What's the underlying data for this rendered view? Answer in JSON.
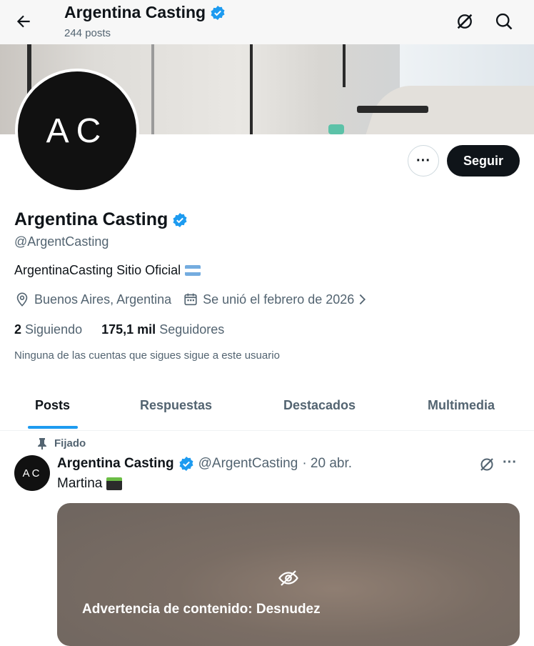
{
  "header": {
    "title": "Argentina Casting",
    "posts_count": "244 posts"
  },
  "profile": {
    "avatar_text": "AC",
    "name": "Argentina Casting",
    "handle": "@ArgentCasting",
    "bio": "ArgentinaCasting Sitio Oficial",
    "location": "Buenos Aires, Argentina",
    "joined": "Se unió el febrero de 2026",
    "following_count": "2",
    "following_label": "Siguiendo",
    "followers_count": "175,1 mil",
    "followers_label": "Seguidores",
    "follow_note": "Ninguna de las cuentas que sigues sigue a este usuario",
    "follow_button": "Seguir",
    "more_button": "···"
  },
  "tabs": [
    "Posts",
    "Respuestas",
    "Destacados",
    "Multimedia"
  ],
  "pinned_post": {
    "pinned_label": "Fijado",
    "avatar_text": "AC",
    "author": "Argentina Casting",
    "handle": "@ArgentCasting",
    "date": "· 20 abr.",
    "text": "Martina",
    "more": "···",
    "warning": "Advertencia de contenido: Desnudez"
  },
  "colors": {
    "accent": "#1d9bf0",
    "text": "#0f1419",
    "muted": "#536471",
    "button_dark": "#0f1419"
  }
}
